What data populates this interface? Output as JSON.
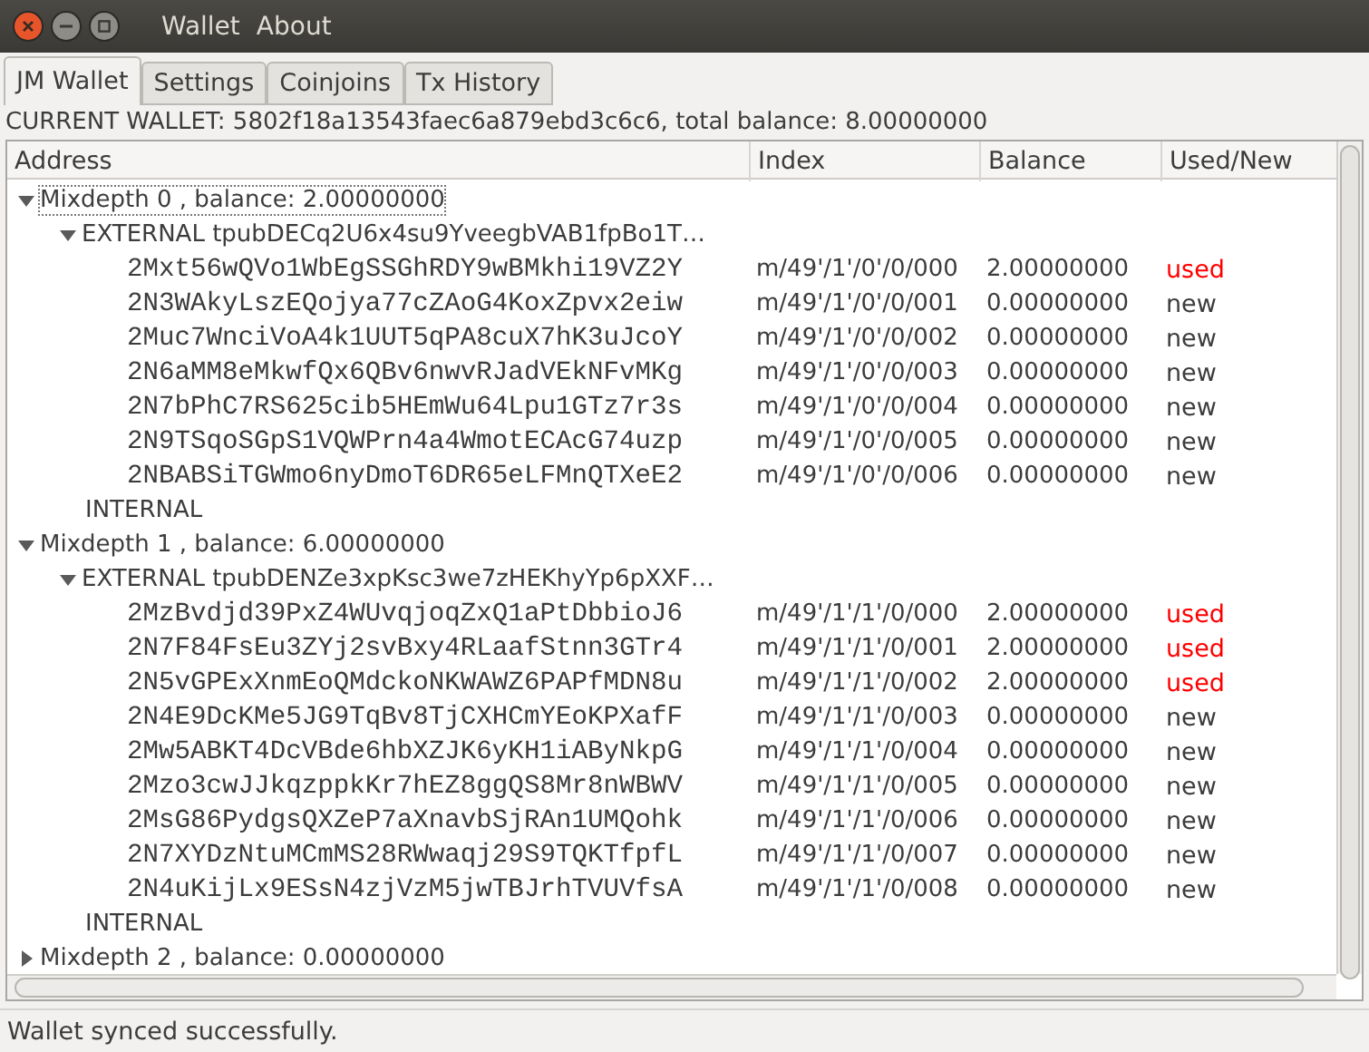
{
  "menu": [
    "Wallet",
    "About"
  ],
  "tabs": [
    {
      "label": "JM Wallet",
      "selected": true
    },
    {
      "label": "Settings",
      "selected": false
    },
    {
      "label": "Coinjoins",
      "selected": false
    },
    {
      "label": "Tx History",
      "selected": false
    }
  ],
  "wallet_info": "CURRENT WALLET: 5802f18a13543faec6a879ebd3c6c6, total balance: 8.00000000",
  "tree": {
    "columns": [
      "Address",
      "Index",
      "Balance",
      "Used/New"
    ],
    "mixdepths": [
      {
        "label": "Mixdepth 0 , balance: 2.00000000",
        "expanded": true,
        "focused": true,
        "branches": [
          {
            "label": "EXTERNAL tpubDECq2U6x4su9YveegbVAB1fpBo1T…",
            "expanded": true,
            "addresses": [
              {
                "address": "2Mxt56wQVo1WbEgSSGhRDY9wBMkhi19VZ2Y",
                "index": "m/49'/1'/0'/0/000",
                "balance": "2.00000000",
                "status": "used",
                "used": true
              },
              {
                "address": "2N3WAkyLszEQojya77cZAoG4KoxZpvx2eiw",
                "index": "m/49'/1'/0'/0/001",
                "balance": "0.00000000",
                "status": "new",
                "used": false
              },
              {
                "address": "2Muc7WnciVoA4k1UUT5qPA8cuX7hK3uJcoY",
                "index": "m/49'/1'/0'/0/002",
                "balance": "0.00000000",
                "status": "new",
                "used": false
              },
              {
                "address": "2N6aMM8eMkwfQx6QBv6nwvRJadVEkNFvMKg",
                "index": "m/49'/1'/0'/0/003",
                "balance": "0.00000000",
                "status": "new",
                "used": false
              },
              {
                "address": "2N7bPhC7RS625cib5HEmWu64Lpu1GTz7r3s",
                "index": "m/49'/1'/0'/0/004",
                "balance": "0.00000000",
                "status": "new",
                "used": false
              },
              {
                "address": "2N9TSqoSGpS1VQWPrn4a4WmotECAcG74uzp",
                "index": "m/49'/1'/0'/0/005",
                "balance": "0.00000000",
                "status": "new",
                "used": false
              },
              {
                "address": "2NBABSiTGWmo6nyDmoT6DR65eLFMnQTXeE2",
                "index": "m/49'/1'/0'/0/006",
                "balance": "0.00000000",
                "status": "new",
                "used": false
              }
            ]
          },
          {
            "label": "INTERNAL"
          }
        ]
      },
      {
        "label": "Mixdepth 1 , balance: 6.00000000",
        "expanded": true,
        "focused": false,
        "branches": [
          {
            "label": "EXTERNAL tpubDENZe3xpKsc3we7zHEKhyYp6pXXF…",
            "expanded": true,
            "addresses": [
              {
                "address": "2MzBvdjd39PxZ4WUvqjoqZxQ1aPtDbbioJ6",
                "index": "m/49'/1'/1'/0/000",
                "balance": "2.00000000",
                "status": "used",
                "used": true
              },
              {
                "address": "2N7F84FsEu3ZYj2svBxy4RLaafStnn3GTr4",
                "index": "m/49'/1'/1'/0/001",
                "balance": "2.00000000",
                "status": "used",
                "used": true
              },
              {
                "address": "2N5vGPExXnmEoQMdckoNKWAWZ6PAPfMDN8u",
                "index": "m/49'/1'/1'/0/002",
                "balance": "2.00000000",
                "status": "used",
                "used": true
              },
              {
                "address": "2N4E9DcKMe5JG9TqBv8TjCXHCmYEoKPXafF",
                "index": "m/49'/1'/1'/0/003",
                "balance": "0.00000000",
                "status": "new",
                "used": false
              },
              {
                "address": "2Mw5ABKT4DcVBde6hbXZJK6yKH1iAByNkpG",
                "index": "m/49'/1'/1'/0/004",
                "balance": "0.00000000",
                "status": "new",
                "used": false
              },
              {
                "address": "2Mzo3cwJJkqzppkKr7hEZ8ggQS8Mr8nWBWV",
                "index": "m/49'/1'/1'/0/005",
                "balance": "0.00000000",
                "status": "new",
                "used": false
              },
              {
                "address": "2MsG86PydgsQXZeP7aXnavbSjRAn1UMQohk",
                "index": "m/49'/1'/1'/0/006",
                "balance": "0.00000000",
                "status": "new",
                "used": false
              },
              {
                "address": "2N7XYDzNtuMCmMS28RWwaqj29S9TQKTfpfL",
                "index": "m/49'/1'/1'/0/007",
                "balance": "0.00000000",
                "status": "new",
                "used": false
              },
              {
                "address": "2N4uKijLx9ESsN4zjVzM5jwTBJrhTVUVfsA",
                "index": "m/49'/1'/1'/0/008",
                "balance": "0.00000000",
                "status": "new",
                "used": false
              }
            ]
          },
          {
            "label": "INTERNAL"
          }
        ]
      },
      {
        "label": "Mixdepth 2 , balance: 0.00000000",
        "expanded": false,
        "focused": false
      }
    ]
  },
  "status_bar": "Wallet synced successfully."
}
